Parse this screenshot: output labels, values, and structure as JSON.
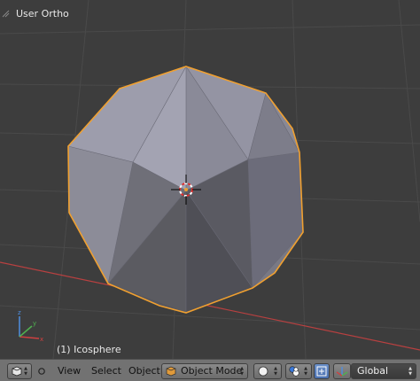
{
  "viewport": {
    "view_name": "User Ortho",
    "object_name": "(1) Icosphere",
    "background": "#3d3d3d",
    "grid_color": "#4a4a4a",
    "x_axis_color": "#b84040",
    "mesh_colors": {
      "light": "#9c9cab",
      "mid": "#7a7a86",
      "dark": "#55555c",
      "outline": "#f0a030"
    },
    "selected": true
  },
  "header": {
    "editor_type_icon": "3d-view-icon",
    "menus": [
      "View",
      "Select",
      "Object"
    ],
    "mode": {
      "label": "Object Mode",
      "icon": "object-mode-cube-icon"
    },
    "viewport_shading_icon": "solid-sphere-icon",
    "pivot_icon": "pivot-point-icon",
    "manipulator_icon": "manipulator-icon",
    "orientation": {
      "label": "Global",
      "icon": "transform-orientation-icon"
    }
  }
}
